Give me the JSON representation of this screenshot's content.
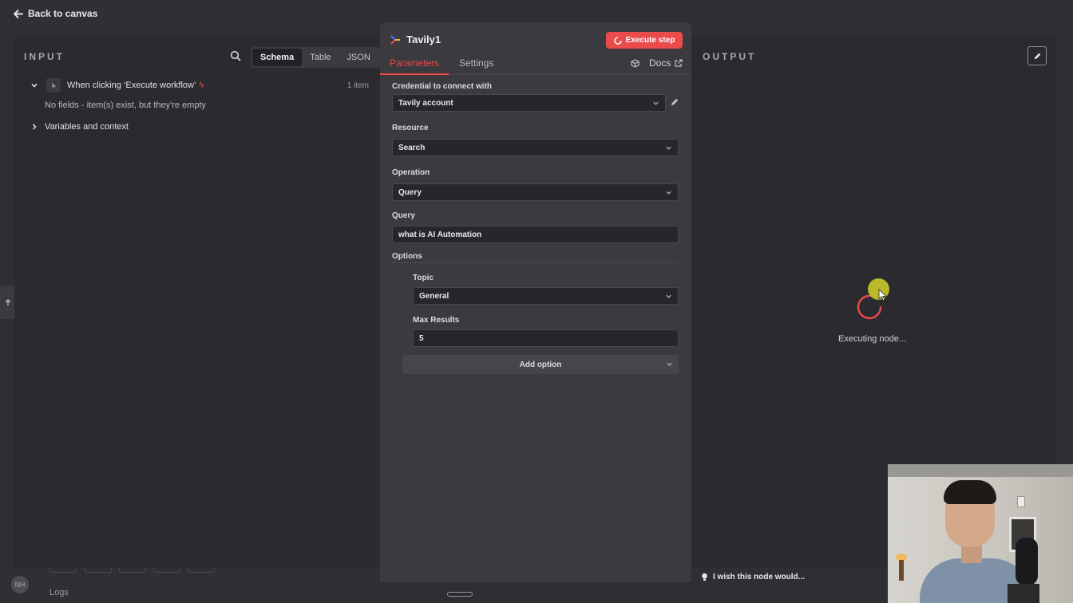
{
  "topbar": {
    "back_label": "Back to canvas"
  },
  "input_panel": {
    "title": "INPUT",
    "view_options": [
      "Schema",
      "Table",
      "JSON"
    ],
    "active_view": "Schema",
    "trigger_node": "When clicking ‘Execute workflow’",
    "item_count": "1 item",
    "empty_note": "No fields - item(s) exist, but they're empty",
    "variables_label": "Variables and context"
  },
  "node": {
    "title": "Tavily1",
    "execute_label": "Execute step",
    "tabs": [
      "Parameters",
      "Settings"
    ],
    "active_tab": "Parameters",
    "docs_label": "Docs",
    "credential_label": "Credential to connect with",
    "credential_value": "Tavily account",
    "resource_label": "Resource",
    "resource_value": "Search",
    "operation_label": "Operation",
    "operation_value": "Query",
    "query_label": "Query",
    "query_value": "what is AI Automation",
    "options_label": "Options",
    "topic_label": "Topic",
    "topic_value": "General",
    "max_results_label": "Max Results",
    "max_results_value": "5",
    "add_option_label": "Add option"
  },
  "output_panel": {
    "title": "OUTPUT",
    "status": "Executing node..."
  },
  "footer": {
    "wish_label": "I wish this node would...",
    "logs_label": "Logs",
    "avatar_initials": "NH"
  },
  "colors": {
    "accent": "#ea4b4b",
    "panel": "#2b2b2f",
    "node_panel": "#3a3a3f",
    "input_bg": "#27272b"
  },
  "icons": [
    "arrow-left-icon",
    "search-icon",
    "chevron-down-icon",
    "chevron-right-icon",
    "cursor-icon",
    "lightning-icon",
    "tavily-logo-icon",
    "spinner-icon",
    "cube-icon",
    "external-link-icon",
    "pencil-icon",
    "lightbulb-icon"
  ]
}
